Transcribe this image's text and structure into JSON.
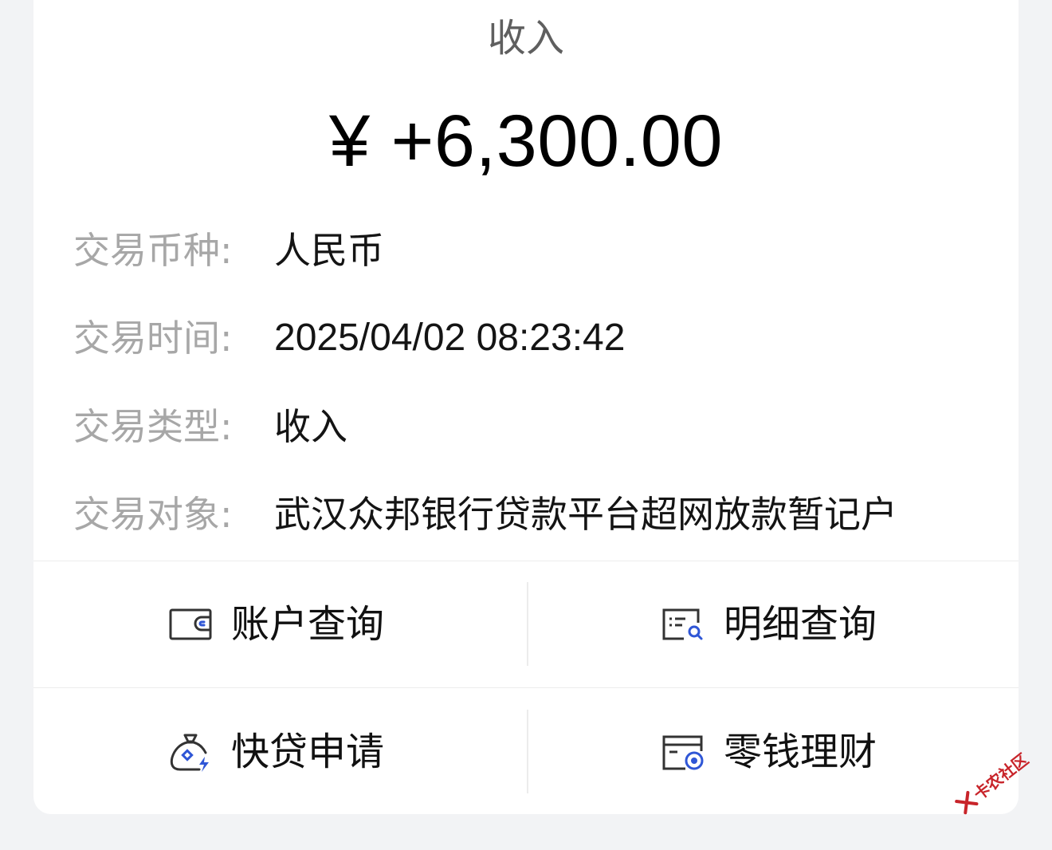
{
  "transaction": {
    "type_title": "收入",
    "amount": "¥ +6,300.00"
  },
  "details": [
    {
      "label": "交易币种:",
      "value": "人民币"
    },
    {
      "label": "交易时间:",
      "value": "2025/04/02 08:23:42"
    },
    {
      "label": "交易类型:",
      "value": "收入"
    },
    {
      "label": "交易对象:",
      "value": "武汉众邦银行贷款平台超网放款暂记户"
    }
  ],
  "actions": [
    {
      "label": "账户查询",
      "icon": "wallet-icon"
    },
    {
      "label": "明细查询",
      "icon": "detail-search-icon"
    },
    {
      "label": "快贷申请",
      "icon": "money-bag-icon"
    },
    {
      "label": "零钱理财",
      "icon": "card-coin-icon"
    }
  ],
  "watermark": {
    "text": "卡农社区"
  },
  "colors": {
    "icon_outline": "#333333",
    "icon_accent": "#2f56d6",
    "label_gray": "#a7a7a7",
    "background": "#f2f3f5",
    "watermark_red": "#c8242a"
  }
}
